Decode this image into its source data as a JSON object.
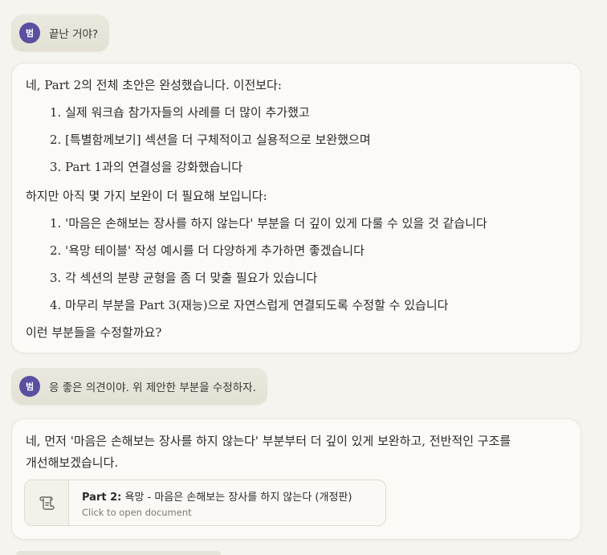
{
  "messages": {
    "user1": {
      "avatar": "범",
      "text": "끝난 거야?"
    },
    "assistant1": {
      "intro": "네, Part 2의 전체 초안은 완성했습니다. 이전보다:",
      "done_items": [
        "1. 실제 워크숍 참가자들의 사례를 더 많이 추가했고",
        "2. [특별함께보기] 섹션을 더 구체적이고 실용적으로 보완했으며",
        "3. Part 1과의 연결성을 강화했습니다"
      ],
      "middle": "하지만 아직 몇 가지 보완이 더 필요해 보입니다:",
      "todo_items": [
        "1. '마음은 손해보는 장사를 하지 않는다' 부분을 더 깊이 있게 다룰 수 있을 것 같습니다",
        "2. '욕망 테이블' 작성 예시를 더 다양하게 추가하면 좋겠습니다",
        "3. 각 섹션의 분량 균형을 좀 더 맞출 필요가 있습니다",
        "4. 마무리 부분을 Part 3(재능)으로 자연스럽게 연결되도록 수정할 수 있습니다"
      ],
      "outro": "이런 부분들을 수정할까요?"
    },
    "user2": {
      "avatar": "범",
      "text": "응 좋은 의견이야. 위 제안한 부분을 수정하자."
    },
    "assistant2": {
      "line1": "네, 먼저 '마음은 손해보는 장사를 하지 않는다' 부분부터 더 깊이 있게 보완하고, 전반적인 구조를",
      "line2": "개선해보겠습니다.",
      "artifact": {
        "icon": "document-scroll-icon",
        "title_prefix": "Part 2:",
        "title_rest": " 욕망 - 마음은 손해보는 장사를 하지 않는다 (개정판)",
        "subtitle": "Click to open document"
      }
    }
  },
  "colors": {
    "background": "#f5f4ef",
    "avatar": "#5a4fa0",
    "card": "#fbfaf7",
    "user_bubble": "#e6e3d8"
  }
}
